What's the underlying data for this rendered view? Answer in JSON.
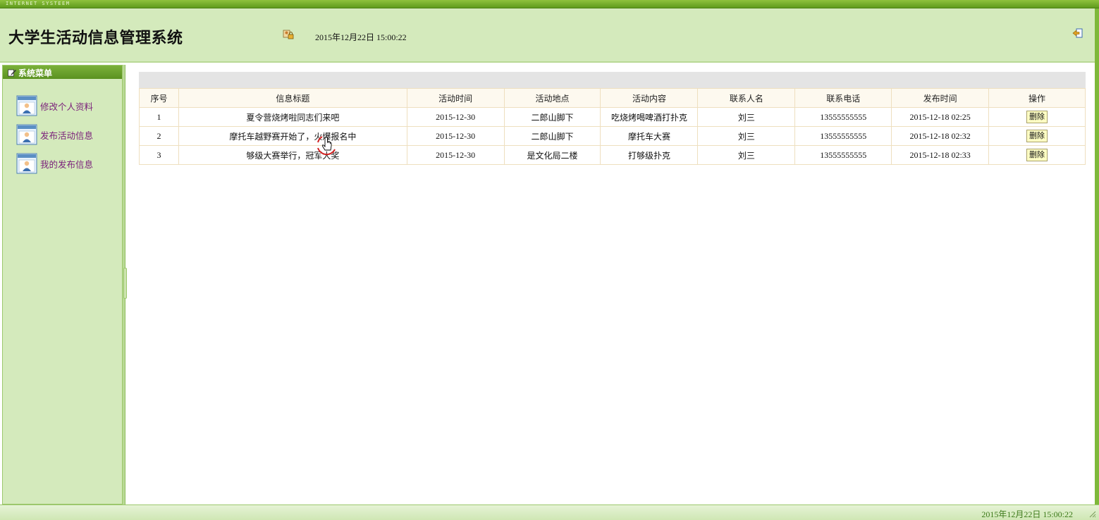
{
  "top_strip": {
    "text": "INTERNET SYSTEEM"
  },
  "header": {
    "title": "大学生活动信息管理系统",
    "datetime": "2015年12月22日  15:00:22",
    "user_icon": "user-lock-icon",
    "logout_icon": "logout-arrow-icon"
  },
  "sidebar": {
    "title": "系统菜单",
    "items": [
      {
        "label": "修改个人资料",
        "icon": "user-profile-icon"
      },
      {
        "label": "发布活动信息",
        "icon": "user-profile-icon"
      },
      {
        "label": "我的发布信息",
        "icon": "user-profile-icon"
      }
    ]
  },
  "table": {
    "headers": [
      "序号",
      "信息标题",
      "活动时间",
      "活动地点",
      "活动内容",
      "联系人名",
      "联系电话",
      "发布时间",
      "操作"
    ],
    "rows": [
      {
        "no": "1",
        "title": "夏令营烧烤啦同志们来吧",
        "date": "2015-12-30",
        "place": "二郎山脚下",
        "content": "吃烧烤喝啤酒打扑克",
        "contact": "刘三",
        "phone": "13555555555",
        "published": "2015-12-18 02:25",
        "action": "删除"
      },
      {
        "no": "2",
        "title": "摩托车越野赛开始了，火爆报名中",
        "date": "2015-12-30",
        "place": "二郎山脚下",
        "content": "摩托车大赛",
        "contact": "刘三",
        "phone": "13555555555",
        "published": "2015-12-18 02:32",
        "action": "删除"
      },
      {
        "no": "3",
        "title": "够级大赛举行，冠军大奖",
        "date": "2015-12-30",
        "place": "是文化局二楼",
        "content": "打够级扑克",
        "contact": "刘三",
        "phone": "13555555555",
        "published": "2015-12-18 02:33",
        "action": "删除"
      }
    ]
  },
  "footer": {
    "datetime": "2015年12月22日  15:00:22"
  },
  "colors": {
    "header_bg": "#d4eabc",
    "accent_green": "#5f9a1c",
    "menu_link": "#7a1f7a",
    "table_border": "#eedfbf",
    "button_bg": "#ffffc4"
  }
}
